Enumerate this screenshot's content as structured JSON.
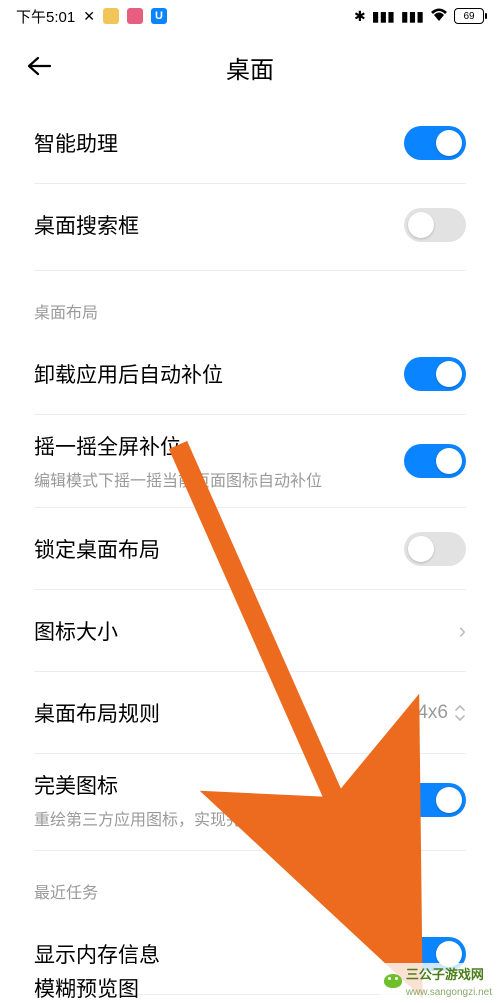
{
  "status": {
    "time": "下午5:01",
    "battery": "69"
  },
  "header": {
    "title": "桌面"
  },
  "top": [
    {
      "label": "智能助理",
      "toggle": true
    },
    {
      "label": "桌面搜索框",
      "toggle": false
    }
  ],
  "section_layout_title": "桌面布局",
  "layout": [
    {
      "label": "卸载应用后自动补位",
      "toggle": true
    },
    {
      "label": "摇一摇全屏补位",
      "sub": "编辑模式下摇一摇当前页面图标自动补位",
      "toggle": true
    },
    {
      "label": "锁定桌面布局",
      "toggle": false
    },
    {
      "label": "图标大小",
      "nav": true
    },
    {
      "label": "桌面布局规则",
      "value": "4x6"
    },
    {
      "label": "完美图标",
      "sub": "重绘第三方应用图标，实现完美动画",
      "toggle": true
    }
  ],
  "section_recent_title": "最近任务",
  "recent": [
    {
      "label": "显示内存信息",
      "toggle": true
    }
  ],
  "cutoff_label": "模糊预览图",
  "watermark": "三公子游戏网",
  "watermark_url": "www.sangongzi.net"
}
